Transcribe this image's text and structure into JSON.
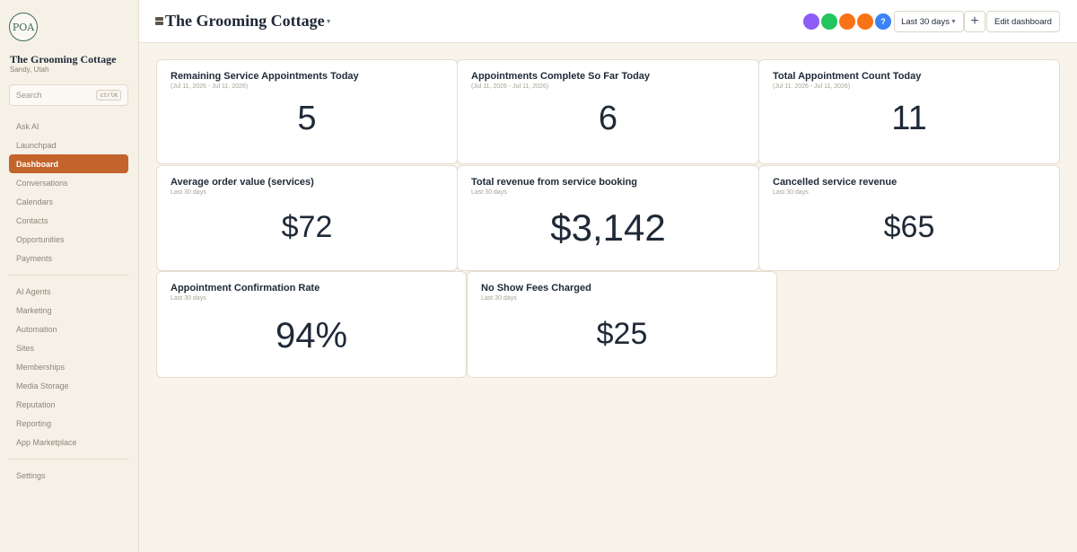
{
  "sidebar": {
    "logo_text": "POA",
    "org_name": "The Grooming Cottage",
    "org_location": "Sandy, Utah",
    "search_placeholder": "Search",
    "search_shortcut": "ctrlK",
    "nav_primary": [
      {
        "label": "Ask AI"
      },
      {
        "label": "Launchpad"
      },
      {
        "label": "Dashboard",
        "active": true
      },
      {
        "label": "Conversations"
      },
      {
        "label": "Calendars"
      },
      {
        "label": "Contacts"
      },
      {
        "label": "Opportunities"
      },
      {
        "label": "Payments"
      }
    ],
    "nav_secondary": [
      {
        "label": "AI Agents"
      },
      {
        "label": "Marketing"
      },
      {
        "label": "Automation"
      },
      {
        "label": "Sites"
      },
      {
        "label": "Memberships"
      },
      {
        "label": "Media Storage"
      },
      {
        "label": "Reputation"
      },
      {
        "label": "Reporting"
      },
      {
        "label": "App Marketplace"
      }
    ],
    "nav_footer": [
      {
        "label": "Settings"
      }
    ]
  },
  "header": {
    "title": "The Grooming Cottage",
    "avatars": [
      {
        "color": "#8b5cf6",
        "label": ""
      },
      {
        "color": "#22c55e",
        "label": ""
      },
      {
        "color": "#f97316",
        "label": ""
      },
      {
        "color": "#f97316",
        "label": ""
      },
      {
        "color": "#3b82f6",
        "label": "?"
      }
    ],
    "date_range": "Last 30 days",
    "add_label": "+",
    "edit_label": "Edit dashboard"
  },
  "cards": [
    {
      "title": "Remaining Service Appointments Today",
      "subtitle": "(Jul 11, 2026 - Jul 11, 2026)",
      "value": "5"
    },
    {
      "title": "Appointments Complete So Far Today",
      "subtitle": "(Jul 11, 2026 - Jul 11, 2026)",
      "value": "6"
    },
    {
      "title": "Total Appointment Count Today",
      "subtitle": "(Jul 11, 2026 - Jul 11, 2026)",
      "value": "11"
    },
    {
      "title": "Average order value (services)",
      "subtitle": "Last 30 days",
      "value": "$72"
    },
    {
      "title": "Total revenue from service booking",
      "subtitle": "Last 30 days",
      "value": "$3,142"
    },
    {
      "title": "Cancelled service revenue",
      "subtitle": "Last 30 days",
      "value": "$65"
    },
    {
      "title": "Appointment Confirmation Rate",
      "subtitle": "Last 30 days",
      "value": "94%"
    },
    {
      "title": "No Show Fees Charged",
      "subtitle": "Last 30 days",
      "value": "$25"
    }
  ],
  "colors": {
    "accent": "#c4642d",
    "background": "#f8f4ec",
    "logo": "#3e6b5a"
  }
}
